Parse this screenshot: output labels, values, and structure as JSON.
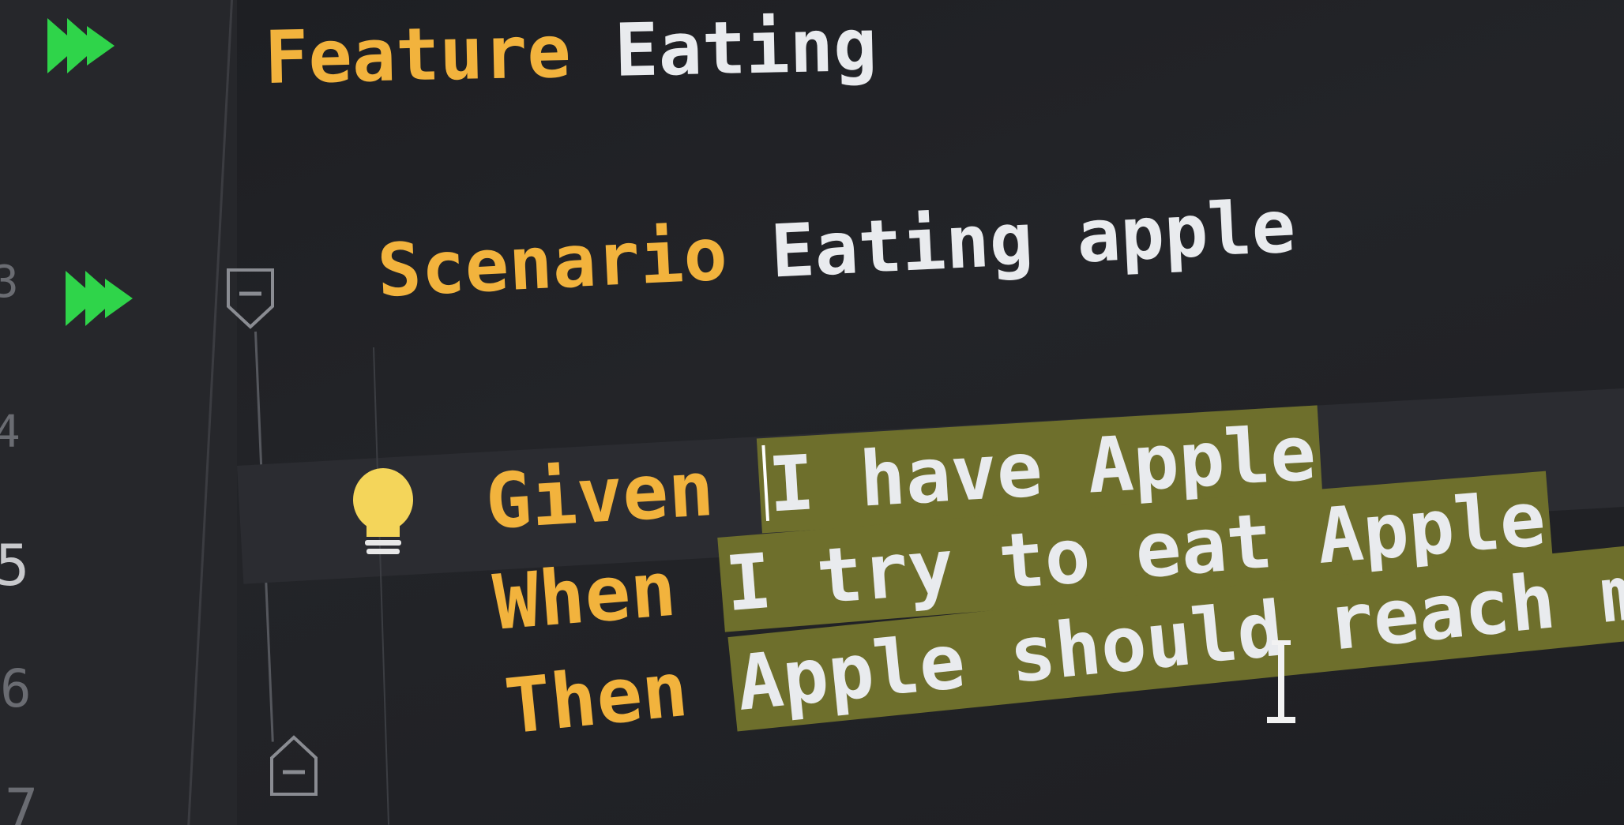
{
  "gutter": {
    "line_numbers": [
      "3",
      "4",
      "5",
      "6",
      "7"
    ]
  },
  "editor": {
    "feature": {
      "keyword": "Feature",
      "text": "Eating"
    },
    "scenario": {
      "keyword": "Scenario",
      "text": "Eating apple"
    },
    "steps": [
      {
        "keyword": "Given",
        "text": "I have Apple"
      },
      {
        "keyword": "When",
        "text": "I try to eat Apple"
      },
      {
        "keyword": "Then",
        "text": "Apple should reach my stomach"
      }
    ]
  },
  "colors": {
    "keyword": "#f2b33d",
    "text": "#e9ebee",
    "selection": "#6e6f2c",
    "run_icon": "#2fd44a",
    "background": "#1e1f23"
  },
  "icons": {
    "run_feature": "run-all-icon",
    "run_scenario": "run-all-icon",
    "intention": "lightbulb-icon",
    "fold_start": "fold-collapse-icon",
    "fold_end": "fold-end-icon",
    "cursor": "text-cursor-icon"
  }
}
